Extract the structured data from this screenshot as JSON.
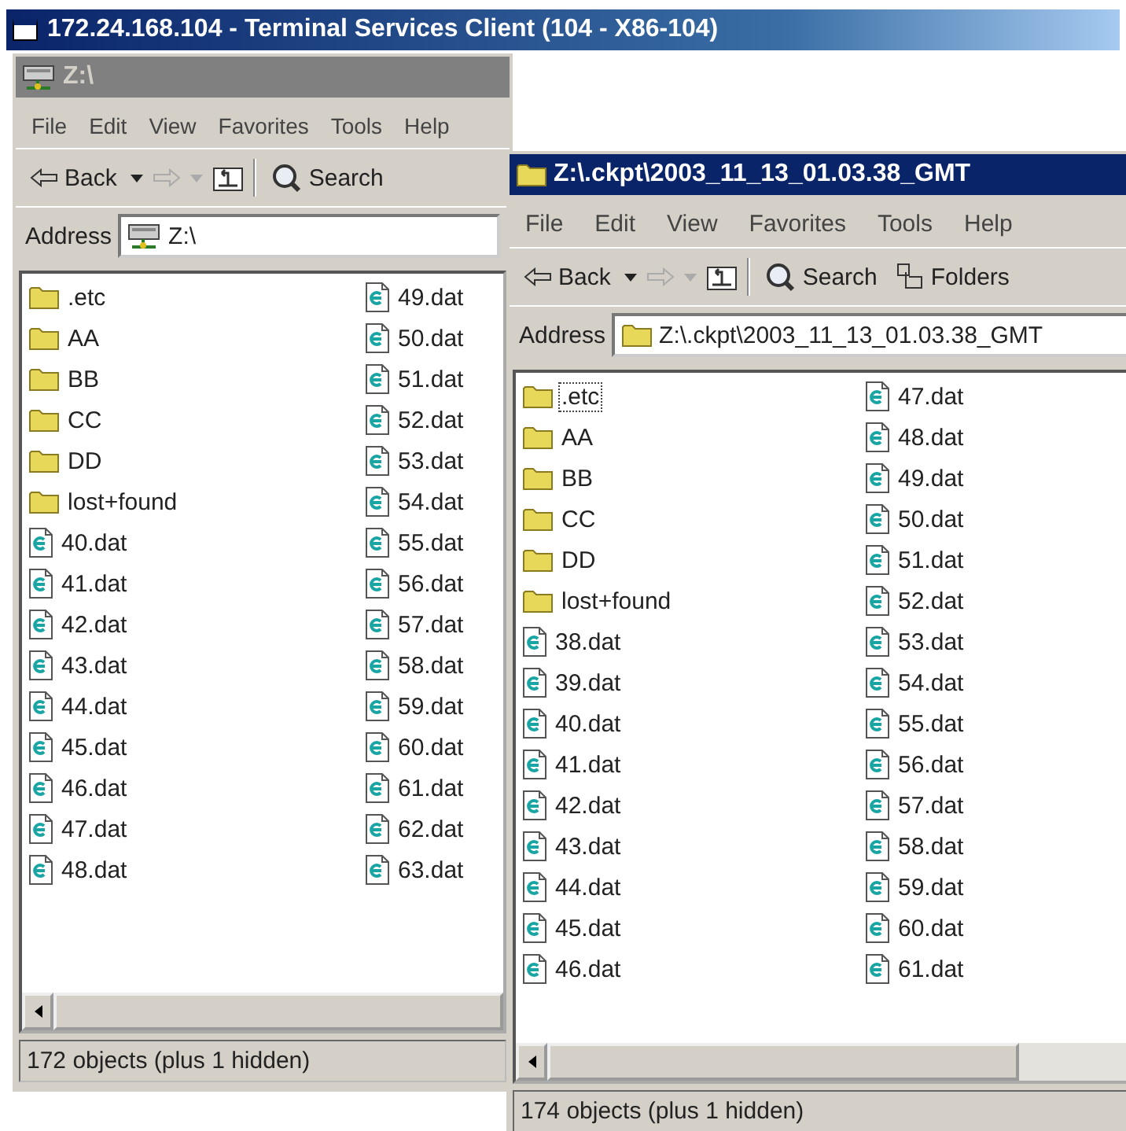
{
  "terminal": {
    "title": "172.24.168.104 - Terminal Services Client (104 - X86-104)"
  },
  "windows": [
    {
      "title": "Z:\\",
      "active": false,
      "menu": [
        "File",
        "Edit",
        "View",
        "Favorites",
        "Tools",
        "Help"
      ],
      "toolbar": [
        {
          "kind": "back",
          "label": "Back"
        },
        {
          "kind": "forward"
        },
        {
          "kind": "up"
        },
        {
          "kind": "search",
          "label": "Search"
        }
      ],
      "address": {
        "label": "Address",
        "value": "Z:\\"
      },
      "items": [
        {
          "name": ".etc",
          "kind": "folder",
          "selected": false
        },
        {
          "name": "AA",
          "kind": "folder",
          "selected": false
        },
        {
          "name": "BB",
          "kind": "folder",
          "selected": false
        },
        {
          "name": "CC",
          "kind": "folder",
          "selected": false
        },
        {
          "name": "DD",
          "kind": "folder",
          "selected": false
        },
        {
          "name": "lost+found",
          "kind": "folder",
          "selected": false
        },
        {
          "name": "40.dat",
          "kind": "file",
          "selected": false
        },
        {
          "name": "41.dat",
          "kind": "file",
          "selected": false
        },
        {
          "name": "42.dat",
          "kind": "file",
          "selected": false
        },
        {
          "name": "43.dat",
          "kind": "file",
          "selected": false
        },
        {
          "name": "44.dat",
          "kind": "file",
          "selected": false
        },
        {
          "name": "45.dat",
          "kind": "file",
          "selected": false
        },
        {
          "name": "46.dat",
          "kind": "file",
          "selected": false
        },
        {
          "name": "47.dat",
          "kind": "file",
          "selected": false
        },
        {
          "name": "48.dat",
          "kind": "file",
          "selected": false
        },
        {
          "name": "49.dat",
          "kind": "file",
          "selected": false
        },
        {
          "name": "50.dat",
          "kind": "file",
          "selected": false
        },
        {
          "name": "51.dat",
          "kind": "file",
          "selected": false
        },
        {
          "name": "52.dat",
          "kind": "file",
          "selected": false
        },
        {
          "name": "53.dat",
          "kind": "file",
          "selected": false
        },
        {
          "name": "54.dat",
          "kind": "file",
          "selected": false
        },
        {
          "name": "55.dat",
          "kind": "file",
          "selected": false
        },
        {
          "name": "56.dat",
          "kind": "file",
          "selected": false
        },
        {
          "name": "57.dat",
          "kind": "file",
          "selected": false
        },
        {
          "name": "58.dat",
          "kind": "file",
          "selected": false
        },
        {
          "name": "59.dat",
          "kind": "file",
          "selected": false
        },
        {
          "name": "60.dat",
          "kind": "file",
          "selected": false
        },
        {
          "name": "61.dat",
          "kind": "file",
          "selected": false
        },
        {
          "name": "62.dat",
          "kind": "file",
          "selected": false
        },
        {
          "name": "63.dat",
          "kind": "file",
          "selected": false
        }
      ],
      "status": "172 objects (plus 1 hidden)"
    },
    {
      "title": "Z:\\.ckpt\\2003_11_13_01.03.38_GMT",
      "active": true,
      "menu": [
        "File",
        "Edit",
        "View",
        "Favorites",
        "Tools",
        "Help"
      ],
      "toolbar": [
        {
          "kind": "back",
          "label": "Back"
        },
        {
          "kind": "forward"
        },
        {
          "kind": "up"
        },
        {
          "kind": "search",
          "label": "Search"
        },
        {
          "kind": "folders",
          "label": "Folders"
        }
      ],
      "address": {
        "label": "Address",
        "value": "Z:\\.ckpt\\2003_11_13_01.03.38_GMT"
      },
      "items": [
        {
          "name": ".etc",
          "kind": "folder",
          "selected": true
        },
        {
          "name": "AA",
          "kind": "folder",
          "selected": false
        },
        {
          "name": "BB",
          "kind": "folder",
          "selected": false
        },
        {
          "name": "CC",
          "kind": "folder",
          "selected": false
        },
        {
          "name": "DD",
          "kind": "folder",
          "selected": false
        },
        {
          "name": "lost+found",
          "kind": "folder",
          "selected": false
        },
        {
          "name": "38.dat",
          "kind": "file",
          "selected": false
        },
        {
          "name": "39.dat",
          "kind": "file",
          "selected": false
        },
        {
          "name": "40.dat",
          "kind": "file",
          "selected": false
        },
        {
          "name": "41.dat",
          "kind": "file",
          "selected": false
        },
        {
          "name": "42.dat",
          "kind": "file",
          "selected": false
        },
        {
          "name": "43.dat",
          "kind": "file",
          "selected": false
        },
        {
          "name": "44.dat",
          "kind": "file",
          "selected": false
        },
        {
          "name": "45.dat",
          "kind": "file",
          "selected": false
        },
        {
          "name": "46.dat",
          "kind": "file",
          "selected": false
        },
        {
          "name": "47.dat",
          "kind": "file",
          "selected": false
        },
        {
          "name": "48.dat",
          "kind": "file",
          "selected": false
        },
        {
          "name": "49.dat",
          "kind": "file",
          "selected": false
        },
        {
          "name": "50.dat",
          "kind": "file",
          "selected": false
        },
        {
          "name": "51.dat",
          "kind": "file",
          "selected": false
        },
        {
          "name": "52.dat",
          "kind": "file",
          "selected": false
        },
        {
          "name": "53.dat",
          "kind": "file",
          "selected": false
        },
        {
          "name": "54.dat",
          "kind": "file",
          "selected": false
        },
        {
          "name": "55.dat",
          "kind": "file",
          "selected": false
        },
        {
          "name": "56.dat",
          "kind": "file",
          "selected": false
        },
        {
          "name": "57.dat",
          "kind": "file",
          "selected": false
        },
        {
          "name": "58.dat",
          "kind": "file",
          "selected": false
        },
        {
          "name": "59.dat",
          "kind": "file",
          "selected": false
        },
        {
          "name": "60.dat",
          "kind": "file",
          "selected": false
        },
        {
          "name": "61.dat",
          "kind": "file",
          "selected": false
        }
      ],
      "status": "174 objects (plus 1 hidden)"
    }
  ]
}
